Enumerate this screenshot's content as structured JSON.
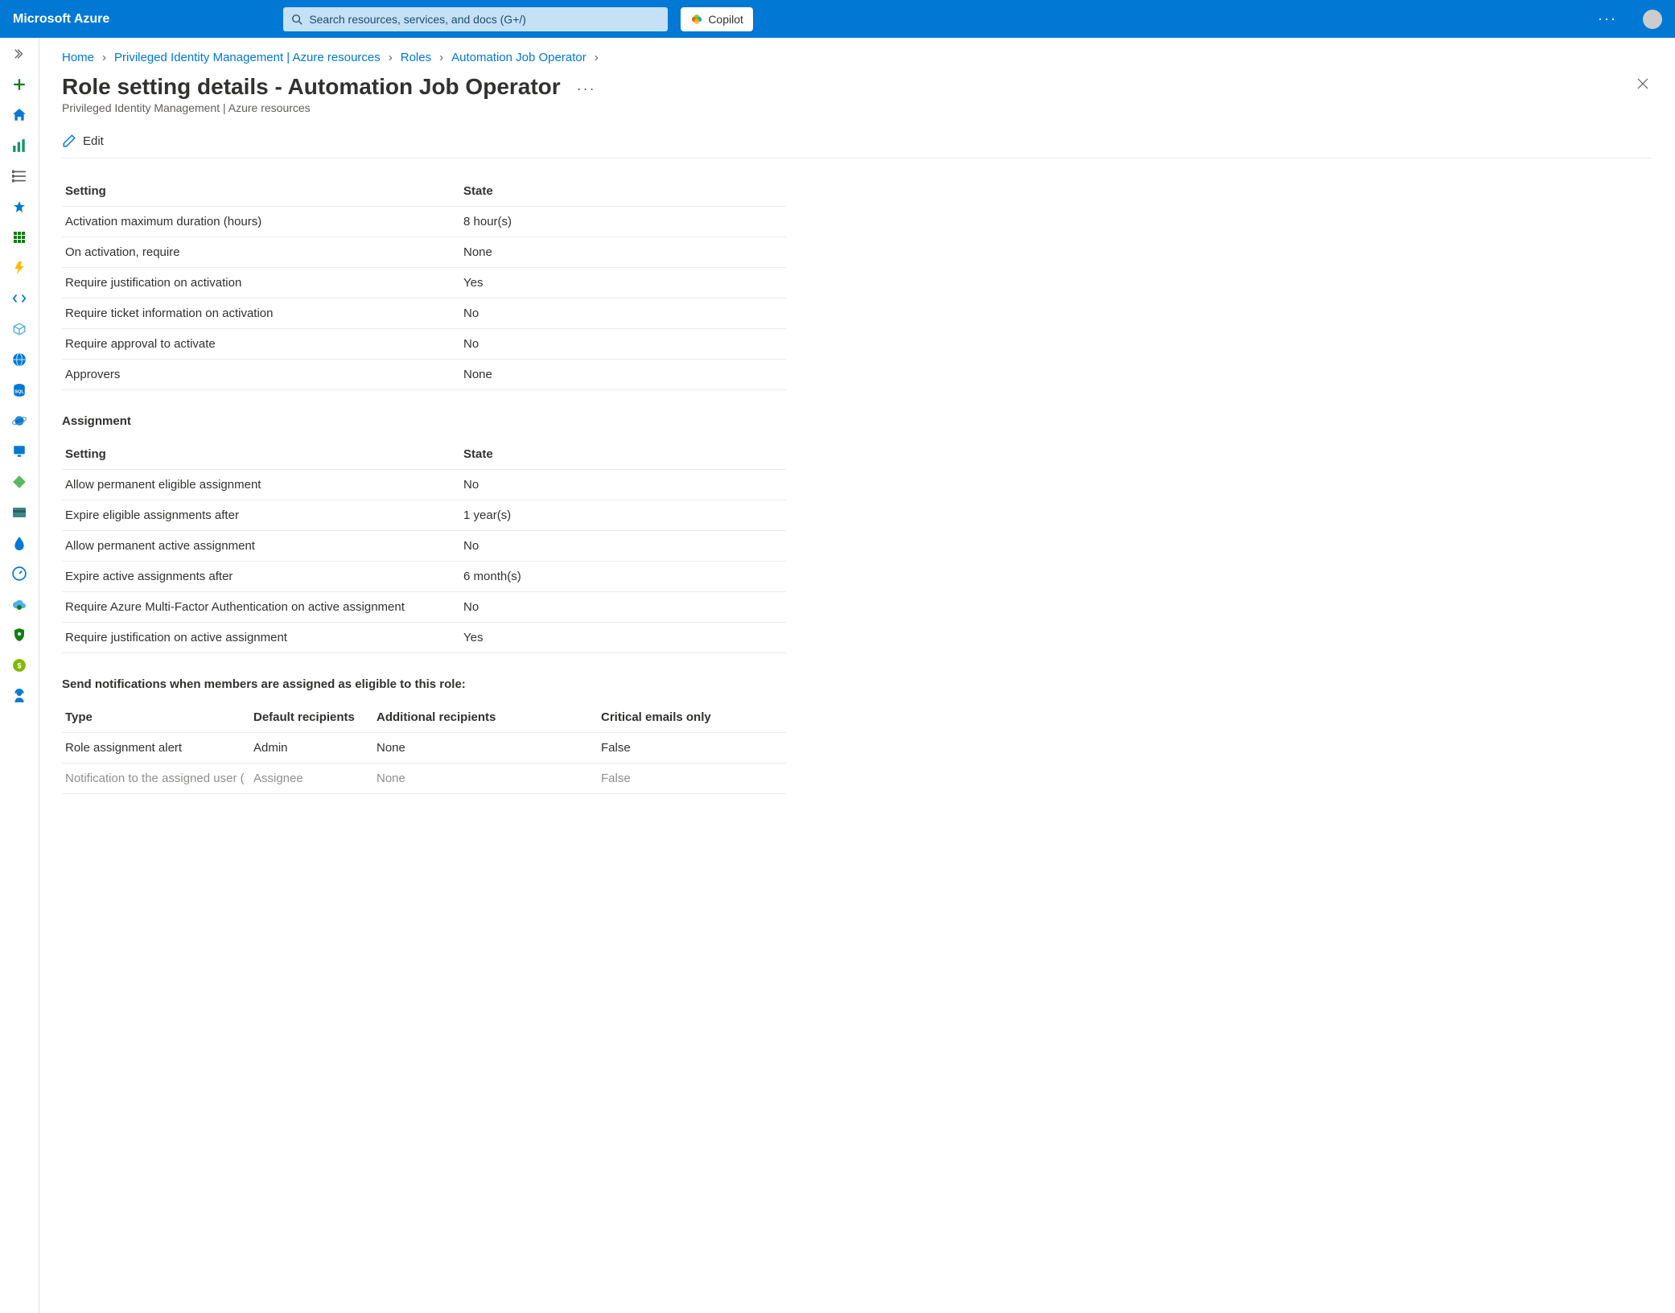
{
  "header": {
    "brand": "Microsoft Azure",
    "search_placeholder": "Search resources, services, and docs (G+/)",
    "copilot_label": "Copilot"
  },
  "breadcrumbs": {
    "items": [
      {
        "label": "Home"
      },
      {
        "label": "Privileged Identity Management | Azure resources"
      },
      {
        "label": "Roles"
      },
      {
        "label": "Automation Job Operator"
      }
    ]
  },
  "page": {
    "title": "Role setting details - Automation Job Operator",
    "subtitle": "Privileged Identity Management | Azure resources",
    "edit_label": "Edit"
  },
  "table_headers": {
    "setting": "Setting",
    "state": "State",
    "type": "Type",
    "default_recipients": "Default recipients",
    "additional_recipients": "Additional recipients",
    "critical_only": "Critical emails only"
  },
  "sections": {
    "assignment": "Assignment",
    "notifications_eligible": "Send notifications when members are assigned as eligible to this role:"
  },
  "activation_rows": [
    {
      "setting": "Activation maximum duration (hours)",
      "state": "8 hour(s)"
    },
    {
      "setting": "On activation, require",
      "state": "None"
    },
    {
      "setting": "Require justification on activation",
      "state": "Yes"
    },
    {
      "setting": "Require ticket information on activation",
      "state": "No"
    },
    {
      "setting": "Require approval to activate",
      "state": "No"
    },
    {
      "setting": "Approvers",
      "state": "None"
    }
  ],
  "assignment_rows": [
    {
      "setting": "Allow permanent eligible assignment",
      "state": "No"
    },
    {
      "setting": "Expire eligible assignments after",
      "state": "1 year(s)"
    },
    {
      "setting": "Allow permanent active assignment",
      "state": "No"
    },
    {
      "setting": "Expire active assignments after",
      "state": "6 month(s)"
    },
    {
      "setting": "Require Azure Multi-Factor Authentication on active assignment",
      "state": "No"
    },
    {
      "setting": "Require justification on active assignment",
      "state": "Yes"
    }
  ],
  "notification_rows": [
    {
      "type": "Role assignment alert",
      "default": "Admin",
      "additional": "None",
      "critical": "False"
    },
    {
      "type": "Notification to the assigned user (",
      "default": "Assignee",
      "additional": "None",
      "critical": "False"
    }
  ]
}
